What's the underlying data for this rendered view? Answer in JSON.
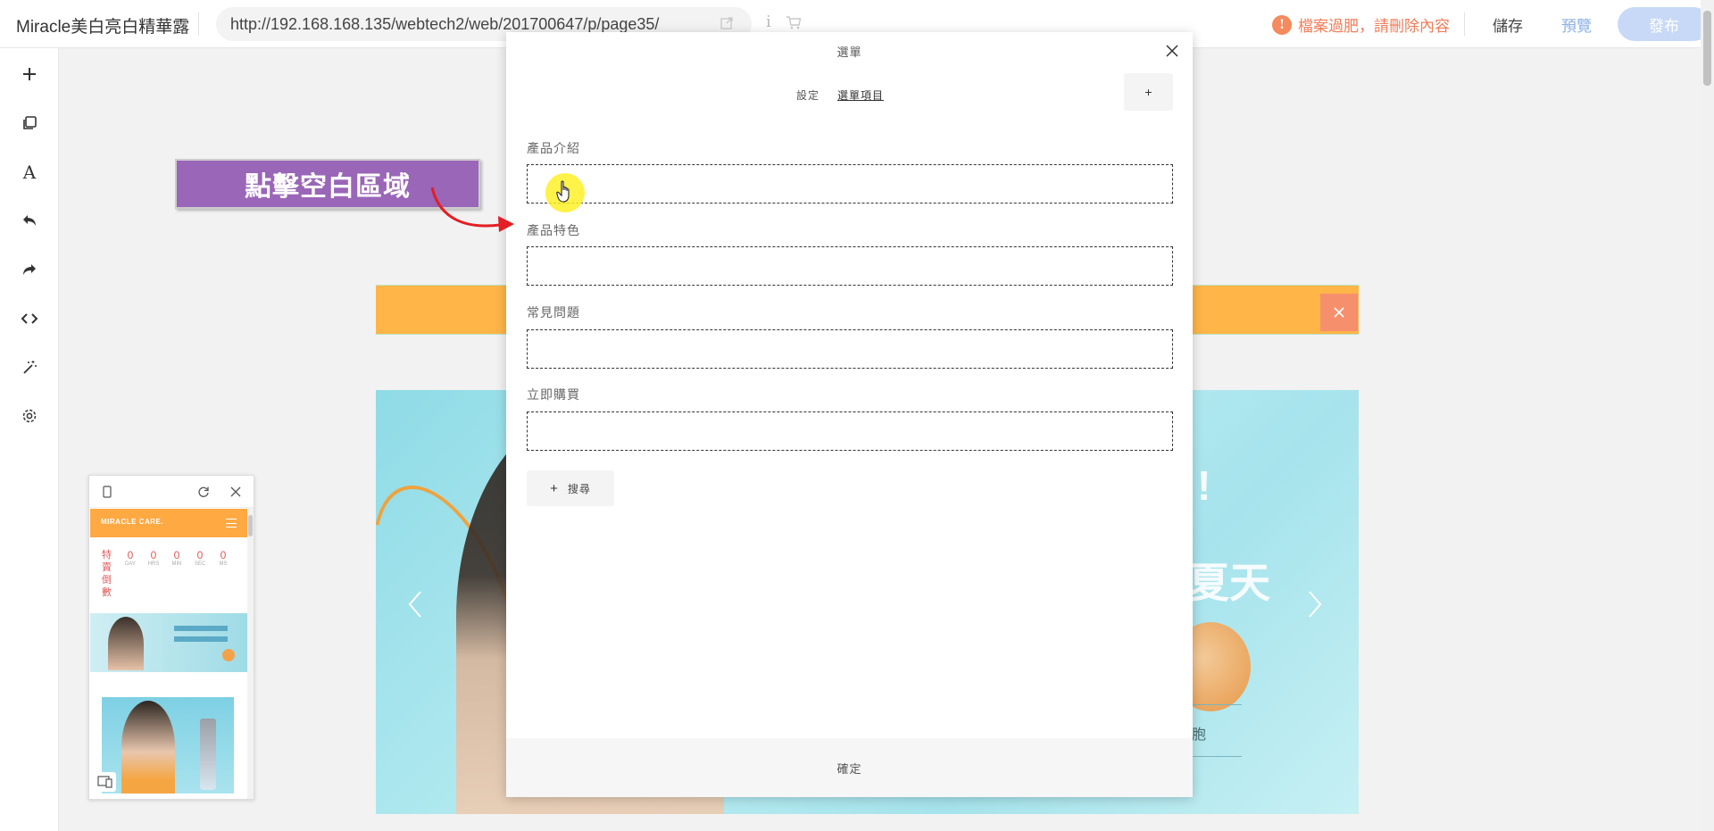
{
  "topbar": {
    "site_name": "Miracle美白亮白精華露",
    "url": "http://192.168.168.135/webtech2/web/201700647/p/page35/",
    "info_glyph": "i",
    "warning": "檔案過肥，請刪除內容",
    "warning_icon": "!",
    "save_label": "儲存",
    "preview_label": "預覽",
    "publish_label": "發布",
    "preview_color": "#8ab0e8",
    "warning_color": "#f07c58"
  },
  "left_toolbar": {
    "items": [
      {
        "name": "add-icon"
      },
      {
        "name": "copy-icon"
      },
      {
        "name": "font-icon",
        "glyph": "A"
      },
      {
        "name": "undo-icon"
      },
      {
        "name": "redo-icon"
      },
      {
        "name": "code-icon"
      },
      {
        "name": "magic-wand-icon"
      },
      {
        "name": "settings-icon"
      }
    ]
  },
  "canvas": {
    "annotation_label": "點擊空白區域",
    "banner_right_text_1": "!",
    "banner_right_text_2": "夏天",
    "banner_right_small": "胞",
    "banner_accent": "#ffb548"
  },
  "mobile_preview": {
    "brand": "MIRACLE CARE.",
    "countdown_label": "特賣倒數",
    "countdown": [
      {
        "value": "0",
        "unit": "DAY"
      },
      {
        "value": "0",
        "unit": "HRS"
      },
      {
        "value": "0",
        "unit": "MIN"
      },
      {
        "value": "0",
        "unit": "SEC"
      },
      {
        "value": "0",
        "unit": "MS"
      }
    ]
  },
  "modal": {
    "title": "選單",
    "tabs": [
      {
        "label": "設定",
        "active": false
      },
      {
        "label": "選單項目",
        "active": true
      }
    ],
    "add_button": "+",
    "fields": [
      {
        "label": "產品介紹",
        "value": ""
      },
      {
        "label": "產品特色",
        "value": ""
      },
      {
        "label": "常見問題",
        "value": ""
      },
      {
        "label": "立即購買",
        "value": ""
      }
    ],
    "add_item_label": "搜尋",
    "add_item_plus": "+",
    "confirm_label": "確定"
  }
}
